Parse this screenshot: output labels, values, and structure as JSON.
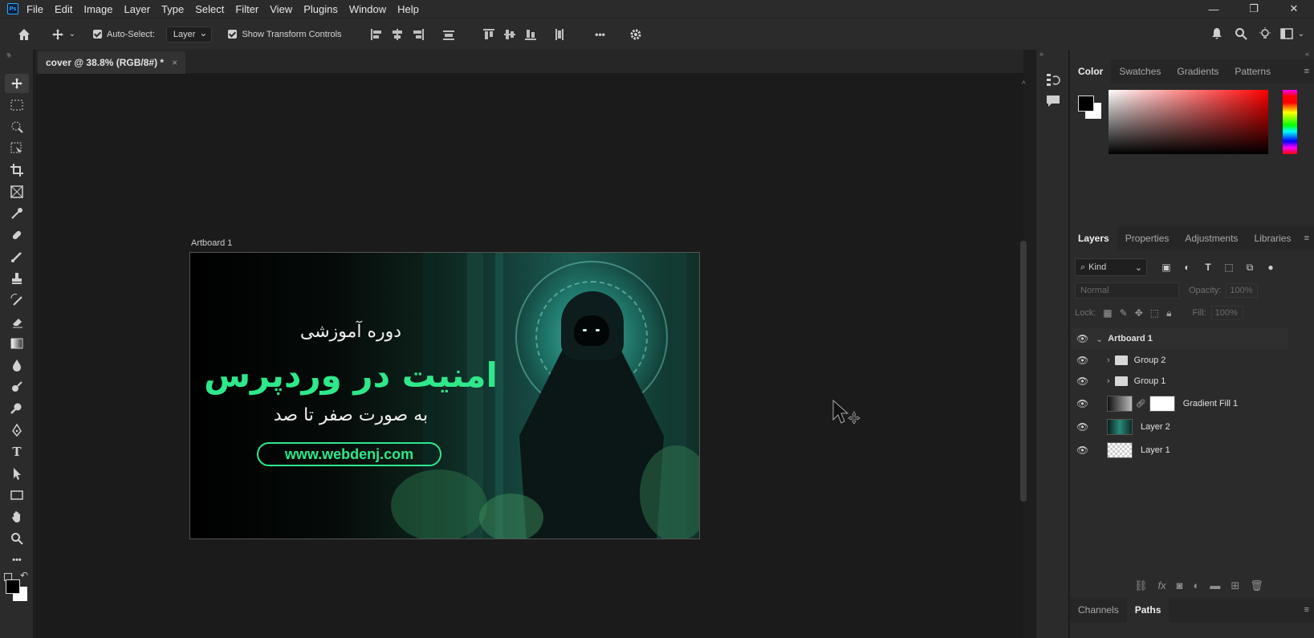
{
  "app": {
    "logo": "Ps"
  },
  "menu": [
    "File",
    "Edit",
    "Image",
    "Layer",
    "Type",
    "Select",
    "Filter",
    "View",
    "Plugins",
    "Window",
    "Help"
  ],
  "window_controls": {
    "minimize": "—",
    "restore": "❐",
    "close": "✕"
  },
  "options": {
    "auto_select_label": "Auto-Select:",
    "auto_select_value": "Layer",
    "transform_label": "Show Transform Controls",
    "more": "•••"
  },
  "document_tab": {
    "title": "cover @ 38.8% (RGB/8#) *",
    "close": "×"
  },
  "artboard": {
    "label": "Artboard 1",
    "line1": "دوره آموزشی",
    "line2": "امنیت در وردپرس",
    "line3": "به صورت صفر تا صد",
    "url": "www.webdenj.com"
  },
  "color_panel": {
    "tabs": [
      "Color",
      "Swatches",
      "Gradients",
      "Patterns"
    ],
    "active": "Color"
  },
  "layers_panel": {
    "tabs": [
      "Layers",
      "Properties",
      "Adjustments",
      "Libraries"
    ],
    "kind_label": "Kind",
    "blend_mode": "Normal",
    "opacity_label": "Opacity:",
    "opacity_value": "100%",
    "lock_label": "Lock:",
    "fill_label": "Fill:",
    "fill_value": "100%",
    "layers": [
      {
        "name": "Artboard 1",
        "type": "artboard"
      },
      {
        "name": "Group 2",
        "type": "group"
      },
      {
        "name": "Group 1",
        "type": "group"
      },
      {
        "name": "Gradient Fill 1",
        "type": "gradient"
      },
      {
        "name": "Layer 2",
        "type": "image"
      },
      {
        "name": "Layer 1",
        "type": "empty"
      }
    ]
  },
  "bottom_panel": {
    "tabs": [
      "Channels",
      "Paths"
    ],
    "active": "Paths"
  },
  "colors": {
    "accent_green": "#2ee88b",
    "bg_dark": "#1b1b1b",
    "panel": "#2b2b2b"
  }
}
